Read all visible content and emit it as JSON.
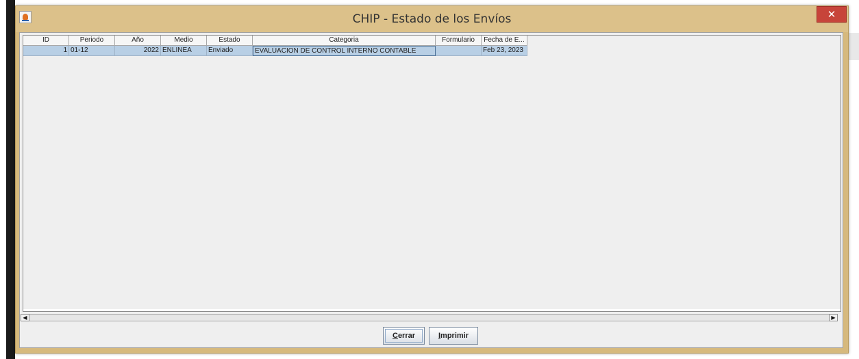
{
  "window": {
    "title": "CHIP - Estado de los Envíos"
  },
  "table": {
    "columns": [
      "ID",
      "Periodo",
      "Año",
      "Medio",
      "Estado",
      "Categoria",
      "Formulario",
      "Fecha de E..."
    ],
    "rows": [
      {
        "id": "1",
        "periodo": "01-12",
        "ano": "2022",
        "medio": "ENLINEA",
        "estado": "Enviado",
        "categoria": "EVALUACION DE CONTROL INTERNO CONTABLE",
        "formulario": "",
        "fecha": "Feb 23, 2023"
      }
    ]
  },
  "buttons": {
    "cerrar_mnemonic": "C",
    "cerrar_rest": "errar",
    "imprimir_mnemonic": "I",
    "imprimir_rest": "mprimir"
  },
  "colors": {
    "titlebar": "#dcc18a",
    "close_button": "#c7443a",
    "row_selected": "#b8cfe5"
  }
}
